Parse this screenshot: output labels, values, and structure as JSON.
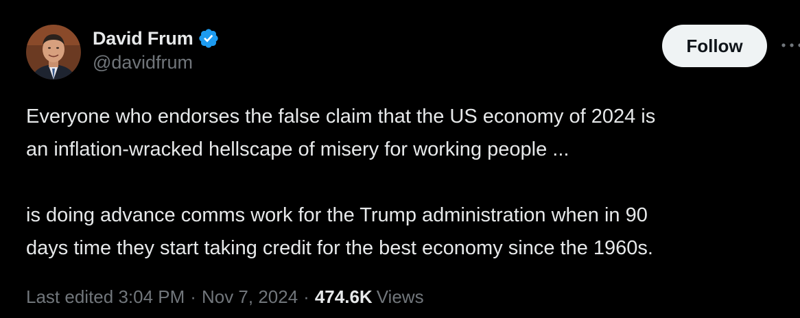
{
  "author": {
    "display_name": "David Frum",
    "handle": "@davidfrum",
    "verified_icon": "verified-badge-icon",
    "verified_color": "#1d9bf0"
  },
  "actions": {
    "follow_label": "Follow",
    "more_icon": "more-horizontal-icon"
  },
  "tweet": {
    "paragraphs": [
      {
        "line1": "Everyone who endorses the false claim that the US economy of 2024 is",
        "line2": "an inflation-wracked hellscape of misery for working people ..."
      },
      {
        "line1": "is doing advance comms work for the Trump administration when in 90",
        "line2": "days time they start taking credit for the best economy since the 1960s."
      }
    ]
  },
  "meta": {
    "edited_label": "Last edited",
    "time": "3:04 PM",
    "separator": "·",
    "date": "Nov 7, 2024",
    "views_count": "474.6K",
    "views_label": "Views"
  },
  "colors": {
    "background": "#000000",
    "primary_text": "#e7e9ea",
    "secondary_text": "#71767b",
    "follow_bg": "#eff3f4"
  }
}
